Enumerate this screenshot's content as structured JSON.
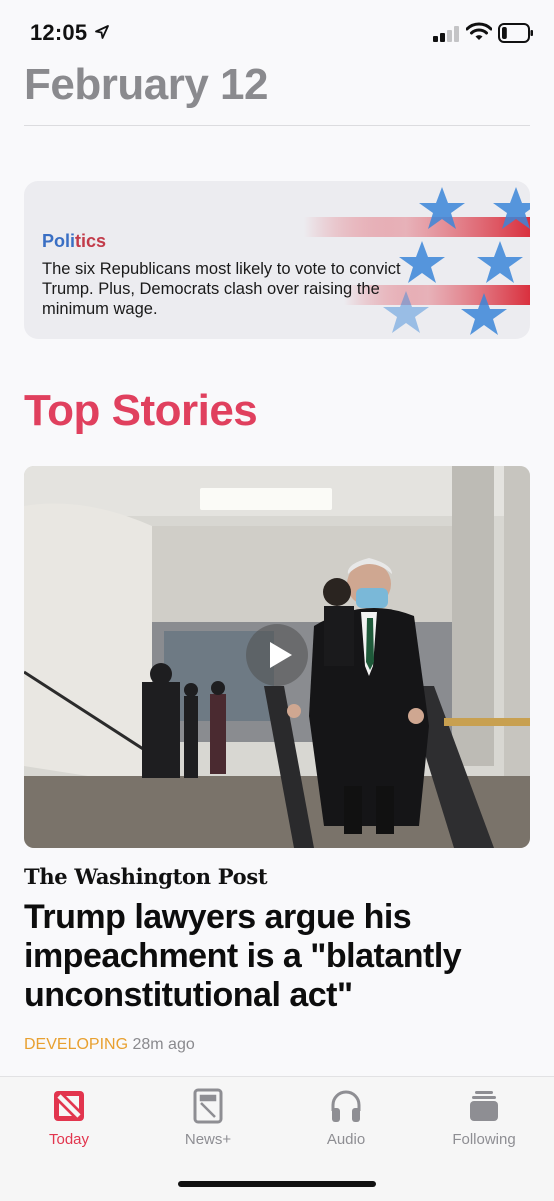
{
  "status_bar": {
    "time": "12:05",
    "battery_level": 0.2
  },
  "date_title": "February 12",
  "politics_card": {
    "label_part_blue": "Poli",
    "label_part_red": "tics",
    "text": "The six Republicans most likely to vote to convict Trump. Plus, Democrats clash over raising the minimum wage."
  },
  "section_title": "Top Stories",
  "story": {
    "publisher": "The Washington Post",
    "headline": "Trump lawyers argue his impeachment is a \"blatantly unconstitutional act\"",
    "status": "DEVELOPING",
    "time_ago": "28m ago"
  },
  "tabs": [
    {
      "label": "Today",
      "icon": "news-icon",
      "active": true
    },
    {
      "label": "News+",
      "icon": "magazine-icon",
      "active": false
    },
    {
      "label": "Audio",
      "icon": "headphones-icon",
      "active": false
    },
    {
      "label": "Following",
      "icon": "following-icon",
      "active": false
    }
  ],
  "colors": {
    "accent": "#e2354e",
    "developing": "#e8a030",
    "politics_blue": "#3a6fc4",
    "politics_red": "#c23b4a"
  }
}
